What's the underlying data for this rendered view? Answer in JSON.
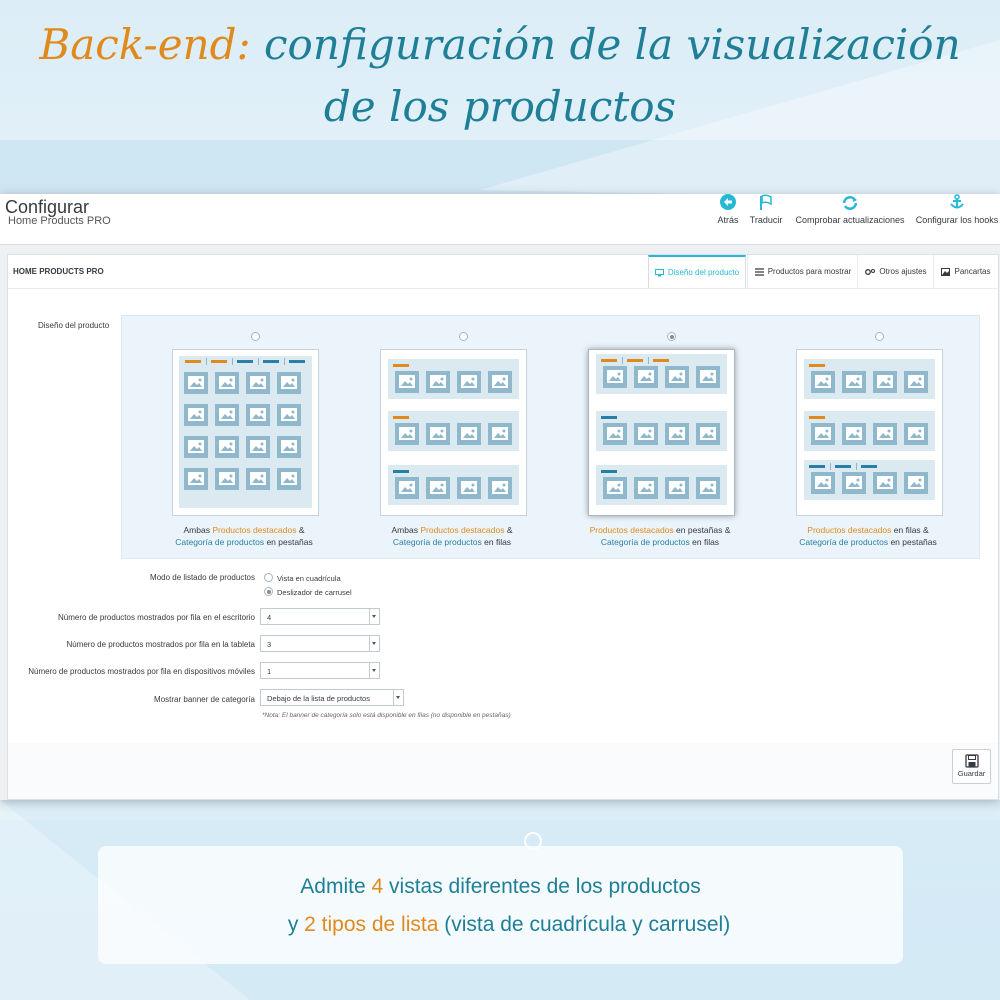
{
  "colors": {
    "accent_orange": "#e08a1e",
    "teal": "#1f7f96",
    "prestashop_blue": "#25b9d7"
  },
  "headline": {
    "part_accent": "Back-end:",
    "part_rest_1": "configuración de la visualización",
    "line2": "de los productos"
  },
  "topbar": {
    "title": "Configurar",
    "subtitle": "Home Products PRO",
    "toolbar": [
      {
        "label": "Atrás",
        "icon": "back-arrow-icon"
      },
      {
        "label": "Traducir",
        "icon": "flag-icon"
      },
      {
        "label": "Comprobar actualizaciones",
        "icon": "refresh-icon"
      },
      {
        "label": "Configurar los hooks",
        "icon": "anchor-icon"
      }
    ]
  },
  "panel": {
    "title": "HOME PRODUCTS PRO",
    "tabs": [
      {
        "label": "Diseño del producto",
        "icon": "monitor-icon",
        "active": true
      },
      {
        "label": "Productos para mostrar",
        "icon": "list-icon",
        "active": false
      },
      {
        "label": "Otros ajustes",
        "icon": "gears-icon",
        "active": false
      },
      {
        "label": "Pancartas",
        "icon": "image-icon",
        "active": false
      }
    ]
  },
  "design": {
    "label": "Diseño del producto",
    "options": [
      {
        "selected": false,
        "cap1_pre": "Ambas ",
        "cap1_hl": "Productos destacados",
        "cap1_post": " &",
        "cap2_hl": "Categoría de productos",
        "cap2_post": " en pestañas"
      },
      {
        "selected": false,
        "cap1_pre": "Ambas ",
        "cap1_hl": "Productos destacados",
        "cap1_post": " &",
        "cap2_hl": "Categoría de productos",
        "cap2_post": " en filas"
      },
      {
        "selected": true,
        "cap1_pre": "",
        "cap1_hl": "Productos destacados",
        "cap1_post": " en pestañas &",
        "cap2_hl": "Categoría de productos",
        "cap2_post": " en filas"
      },
      {
        "selected": false,
        "cap1_pre": "",
        "cap1_hl": "Productos destacados",
        "cap1_post": " en filas &",
        "cap2_hl": "Categoría de productos",
        "cap2_post": " en pestañas"
      }
    ]
  },
  "form": {
    "list_mode_label": "Modo de listado de productos",
    "list_mode_options": [
      {
        "label": "Vista en cuadrícula",
        "selected": false
      },
      {
        "label": "Deslizador de carrusel",
        "selected": true
      }
    ],
    "desktop_label": "Número de productos mostrados por fila en el escritorio",
    "desktop_value": "4",
    "tablet_label": "Número de productos mostrados por fila en la tableta",
    "tablet_value": "3",
    "mobile_label": "Número de productos mostrados por fila en dispositivos móviles",
    "mobile_value": "1",
    "banner_label": "Mostrar banner de categoría",
    "banner_value": "Debajo de la lista de productos",
    "note": "*Nota: El banner de categoría solo está disponible en filas (no disponible en pestañas)"
  },
  "footer": {
    "save_label": "Guardar"
  },
  "bottom": {
    "l1_a": "Admite ",
    "l1_b": "4",
    "l1_c": " vistas diferentes de los productos",
    "l2_a": "y ",
    "l2_b": "2 tipos de lista",
    "l2_c": " (vista de cuadrícula y carrusel)"
  }
}
